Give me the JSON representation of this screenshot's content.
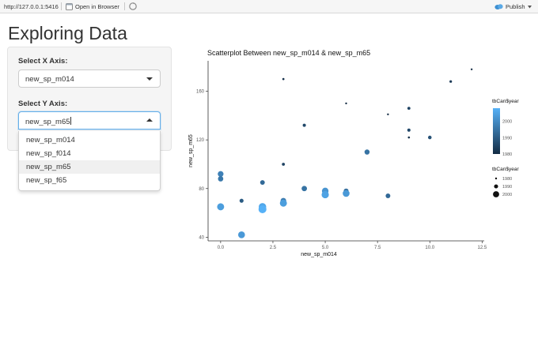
{
  "toolbar": {
    "url": "http://127.0.0.1:5416",
    "open_in_browser": "Open in Browser",
    "publish": "Publish"
  },
  "page": {
    "title": "Exploring Data"
  },
  "sidebar": {
    "x_label": "Select X Axis:",
    "x_value": "new_sp_m014",
    "y_label": "Select Y Axis:",
    "y_value": "new_sp_m65",
    "options": [
      "new_sp_m014",
      "new_sp_f014",
      "new_sp_m65",
      "new_sp_f65"
    ],
    "highlighted_index": 2
  },
  "colors": {
    "dark": "#132b43",
    "light": "#56b1f7"
  },
  "chart_data": {
    "type": "scatter",
    "title": "Scatterplot Between new_sp_m014 & new_sp_m65",
    "xlabel": "new_sp_m014",
    "ylabel": "new_sp_m65",
    "xlim": [
      -0.6,
      12.6
    ],
    "ylim": [
      37,
      185
    ],
    "x_ticks": [
      "0.0",
      "2.5",
      "5.0",
      "7.5",
      "10.0",
      "12.5"
    ],
    "x_tick_values": [
      0,
      2.5,
      5,
      7.5,
      10,
      12.5
    ],
    "y_ticks": [
      "40",
      "80",
      "120",
      "160"
    ],
    "y_tick_values": [
      40,
      80,
      120,
      160
    ],
    "year_range": [
      1980,
      2008
    ],
    "points": [
      {
        "x": 0,
        "y": 92,
        "year": 1998
      },
      {
        "x": 0,
        "y": 88,
        "year": 1996
      },
      {
        "x": 0,
        "y": 65,
        "year": 2004
      },
      {
        "x": 1,
        "y": 70,
        "year": 1990
      },
      {
        "x": 1,
        "y": 42,
        "year": 2003
      },
      {
        "x": 2,
        "y": 85,
        "year": 1993
      },
      {
        "x": 2,
        "y": 65,
        "year": 2006
      },
      {
        "x": 2,
        "y": 63,
        "year": 2008
      },
      {
        "x": 3,
        "y": 70,
        "year": 1997
      },
      {
        "x": 3,
        "y": 68,
        "year": 2004
      },
      {
        "x": 3,
        "y": 100,
        "year": 1985
      },
      {
        "x": 3,
        "y": 170,
        "year": 1981
      },
      {
        "x": 4,
        "y": 80,
        "year": 1996
      },
      {
        "x": 4,
        "y": 80,
        "year": 1995
      },
      {
        "x": 4,
        "y": 132,
        "year": 1986
      },
      {
        "x": 5,
        "y": 78,
        "year": 2002
      },
      {
        "x": 5,
        "y": 75,
        "year": 2005
      },
      {
        "x": 6,
        "y": 78,
        "year": 1994
      },
      {
        "x": 6,
        "y": 76,
        "year": 2003
      },
      {
        "x": 6,
        "y": 150,
        "year": 1980
      },
      {
        "x": 7,
        "y": 110,
        "year": 1995
      },
      {
        "x": 8,
        "y": 74,
        "year": 1993
      },
      {
        "x": 8,
        "y": 141,
        "year": 1980
      },
      {
        "x": 9,
        "y": 146,
        "year": 1985
      },
      {
        "x": 9,
        "y": 128,
        "year": 1986
      },
      {
        "x": 9,
        "y": 122,
        "year": 1981
      },
      {
        "x": 10,
        "y": 122,
        "year": 1988
      },
      {
        "x": 11,
        "y": 168,
        "year": 1983
      },
      {
        "x": 12,
        "y": 178,
        "year": 1980
      }
    ],
    "legend_color": {
      "title": "tbCan$year",
      "labels": [
        "2000",
        "1990",
        "1980"
      ],
      "values": [
        2000,
        1990,
        1980
      ]
    },
    "legend_size": {
      "title": "tbCan$year",
      "labels": [
        "1980",
        "1990",
        "2000"
      ],
      "values": [
        1980,
        1990,
        2000
      ]
    }
  }
}
